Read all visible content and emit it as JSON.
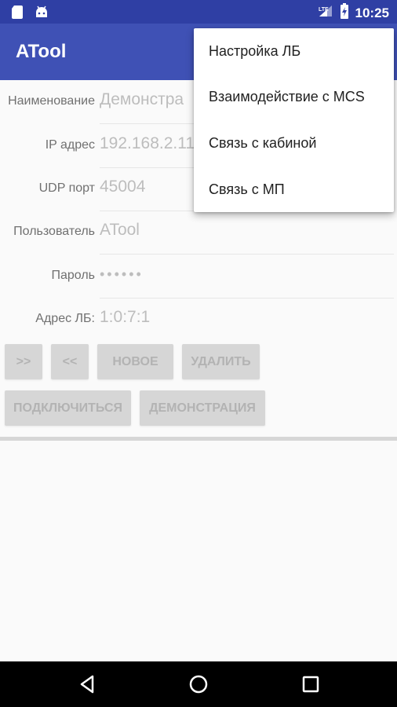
{
  "status_bar": {
    "time": "10:25",
    "icons": [
      "sd-card-icon",
      "android-icon",
      "signal-icon",
      "battery-icon"
    ]
  },
  "app_bar": {
    "title": "ATool",
    "color": "#3f51b5"
  },
  "form": {
    "fields": [
      {
        "label": "Наименование",
        "value": "Демонстра"
      },
      {
        "label": "IP адрес",
        "value": "192.168.2.11"
      },
      {
        "label": "UDP порт",
        "value": "45004"
      },
      {
        "label": "Пользователь",
        "value": "ATool"
      },
      {
        "label": "Пароль",
        "value": "••••••"
      },
      {
        "label": "Адрес ЛБ:",
        "value": "1:0:7:1"
      }
    ]
  },
  "buttons": {
    "next": ">>",
    "prev": "<<",
    "new": "НОВОЕ",
    "delete": "УДАЛИТЬ",
    "connect": "ПОДКЛЮЧИТЬСЯ",
    "demo": "ДЕМОНСТРАЦИЯ"
  },
  "overflow_menu": {
    "items": [
      {
        "label": "Настройка ЛБ"
      },
      {
        "label": "Взаимодействие с MCS"
      },
      {
        "label": "Связь с кабиной"
      },
      {
        "label": "Связь с МП"
      }
    ]
  },
  "nav_bar": {
    "icons": [
      "back-icon",
      "home-icon",
      "recents-icon"
    ]
  }
}
